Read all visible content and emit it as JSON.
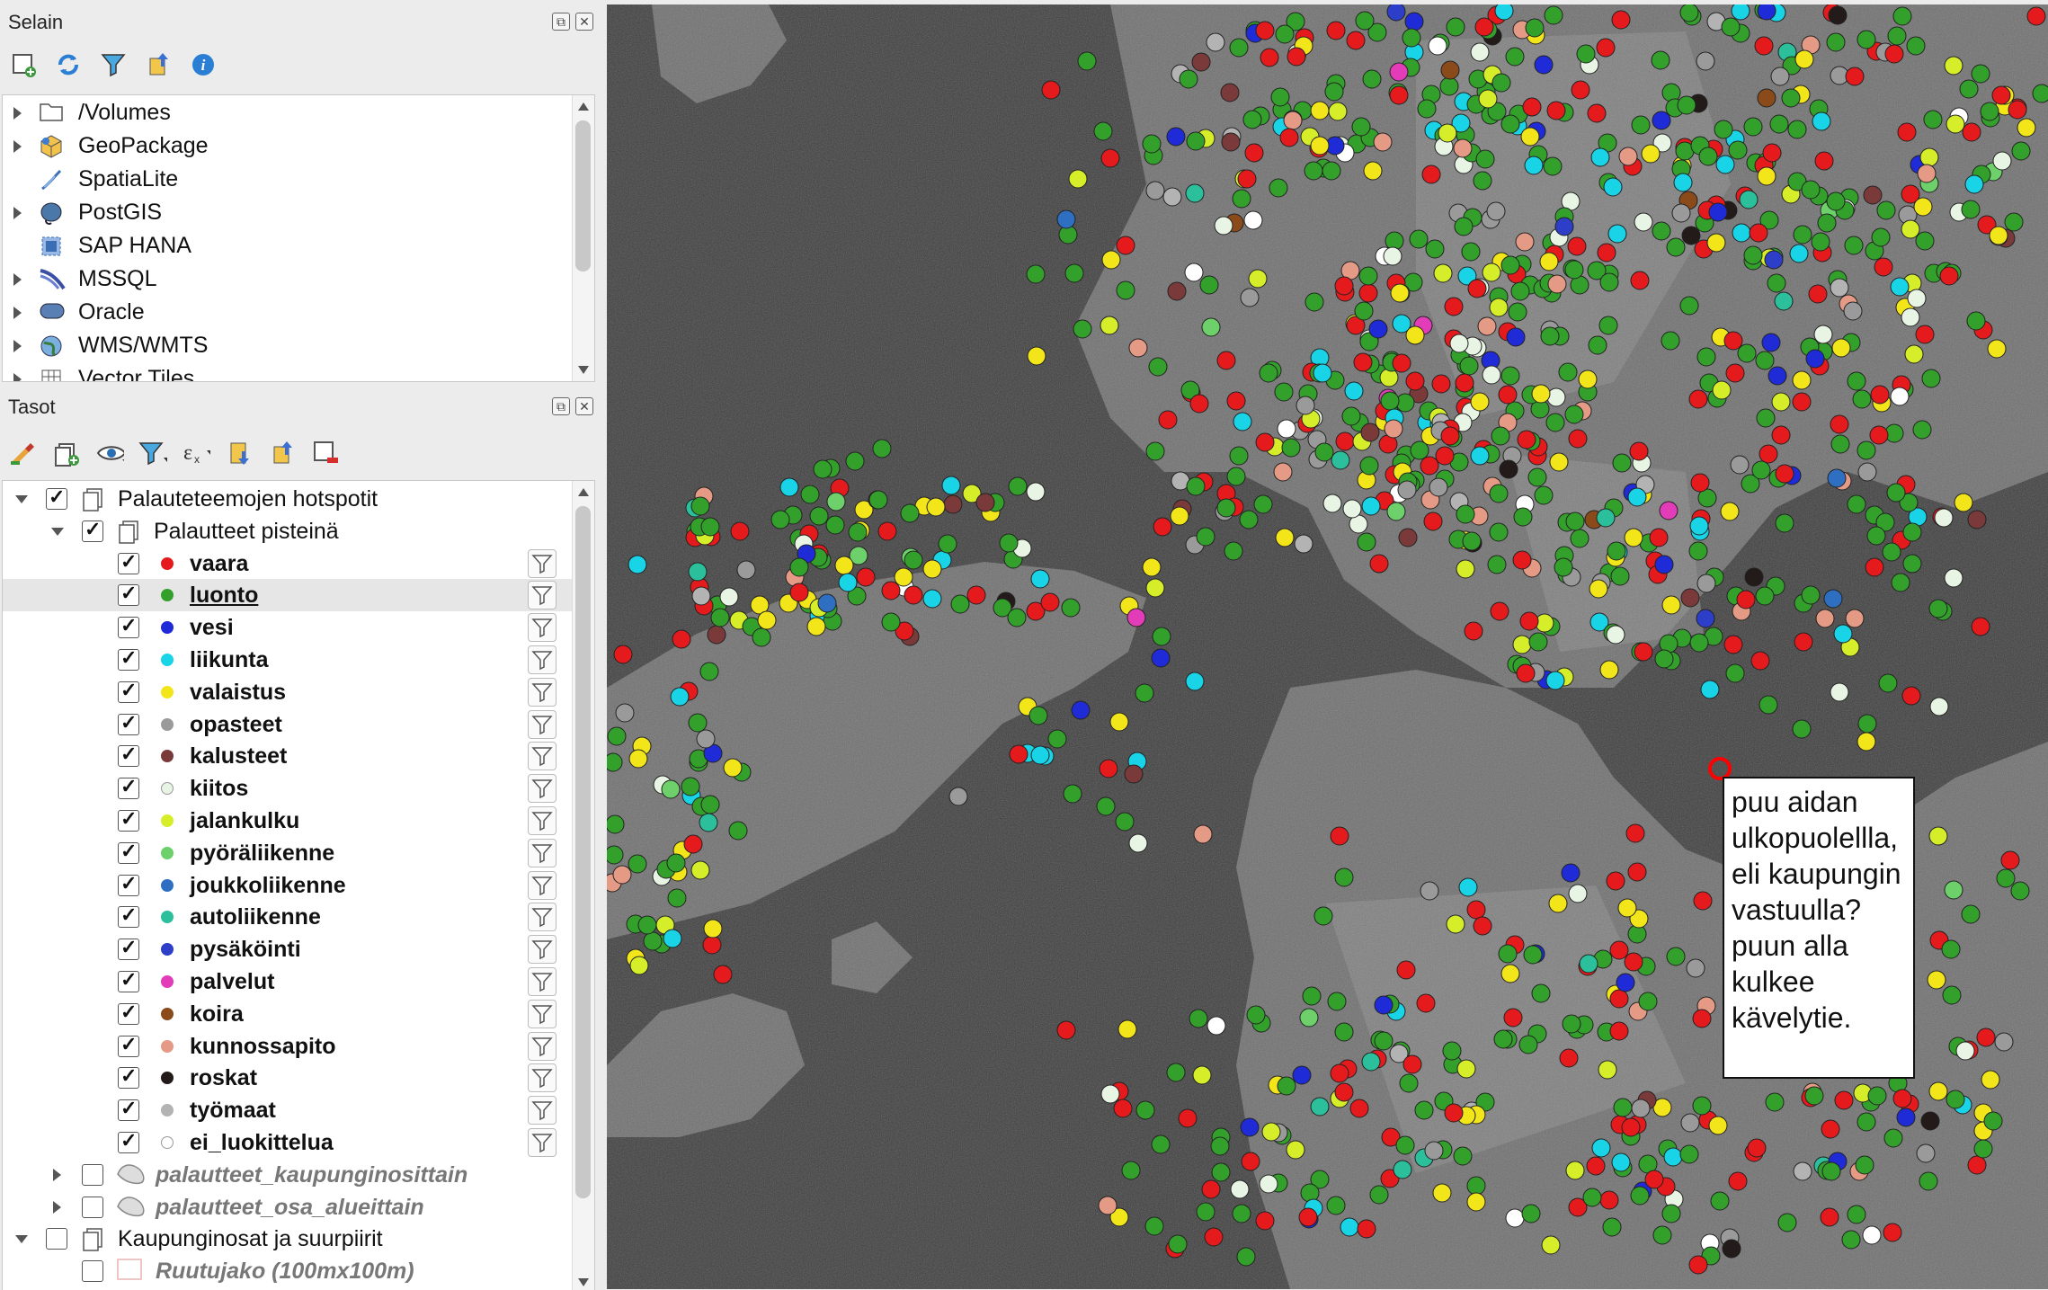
{
  "browser_panel": {
    "title": "Selain",
    "items": [
      {
        "label": "/Volumes",
        "icon": "folder-icon",
        "expandable": true
      },
      {
        "label": "GeoPackage",
        "icon": "geopackage-icon",
        "expandable": true
      },
      {
        "label": "SpatiaLite",
        "icon": "spatialite-icon",
        "expandable": false
      },
      {
        "label": "PostGIS",
        "icon": "postgis-icon",
        "expandable": true
      },
      {
        "label": "SAP HANA",
        "icon": "sap-hana-icon",
        "expandable": false
      },
      {
        "label": "MSSQL",
        "icon": "mssql-icon",
        "expandable": true
      },
      {
        "label": "Oracle",
        "icon": "oracle-icon",
        "expandable": true
      },
      {
        "label": "WMS/WMTS",
        "icon": "wms-icon",
        "expandable": true
      },
      {
        "label": "Vector Tiles",
        "icon": "vector-tiles-icon",
        "expandable": true
      }
    ]
  },
  "layers_panel": {
    "title": "Tasot",
    "tree": [
      {
        "label": "Palauteteemojen hotspotit",
        "type": "group",
        "checked": true
      },
      {
        "label": "Palautteet pisteinä",
        "type": "group",
        "checked": true
      },
      {
        "label": "vaara",
        "color": "#e41a1c",
        "checked": true
      },
      {
        "label": "luonto",
        "color": "#33a02c",
        "checked": true,
        "selected": true
      },
      {
        "label": "vesi",
        "color": "#1f2bd6",
        "checked": true
      },
      {
        "label": "liikunta",
        "color": "#19d3e6",
        "checked": true
      },
      {
        "label": "valaistus",
        "color": "#f2e61a",
        "checked": true
      },
      {
        "label": "opasteet",
        "color": "#9a9a9a",
        "checked": true
      },
      {
        "label": "kalusteet",
        "color": "#7b3a3a",
        "checked": true
      },
      {
        "label": "kiitos",
        "color": "#e8f5e4",
        "checked": true
      },
      {
        "label": "jalankulku",
        "color": "#d6ee2a",
        "checked": true
      },
      {
        "label": "pyöräliikenne",
        "color": "#6dd06a",
        "checked": true
      },
      {
        "label": "joukkoliikenne",
        "color": "#2e6fc2",
        "checked": true
      },
      {
        "label": "autoliikenne",
        "color": "#2bbf9c",
        "checked": true
      },
      {
        "label": "pysäköinti",
        "color": "#2d3ec9",
        "checked": true
      },
      {
        "label": "palvelut",
        "color": "#e23cb8",
        "checked": true
      },
      {
        "label": "koira",
        "color": "#8a4a1a",
        "checked": true
      },
      {
        "label": "kunnossapito",
        "color": "#e59a86",
        "checked": true
      },
      {
        "label": "roskat",
        "color": "#231a1a",
        "checked": true
      },
      {
        "label": "työmaat",
        "color": "#b3b3b3",
        "checked": true
      },
      {
        "label": "ei_luokittelua",
        "color": "#ffffff",
        "checked": true
      },
      {
        "label": "palautteet_kaupunginosittain",
        "type": "polygon-layer",
        "checked": false
      },
      {
        "label": "palautteet_osa_alueittain",
        "type": "polygon-layer",
        "checked": false
      },
      {
        "label": "Kaupunginosat ja suurpiirit",
        "type": "group",
        "checked": false
      },
      {
        "label": "Ruutujako (100mx100m)",
        "type": "polygon-layer",
        "checked": false
      }
    ]
  },
  "map": {
    "callout_text": "puu aidan ulkopuolellla, eli kaupungin vastuulla? puun alla kulkee kävelytie.",
    "highlight_color": "#ff0000"
  }
}
